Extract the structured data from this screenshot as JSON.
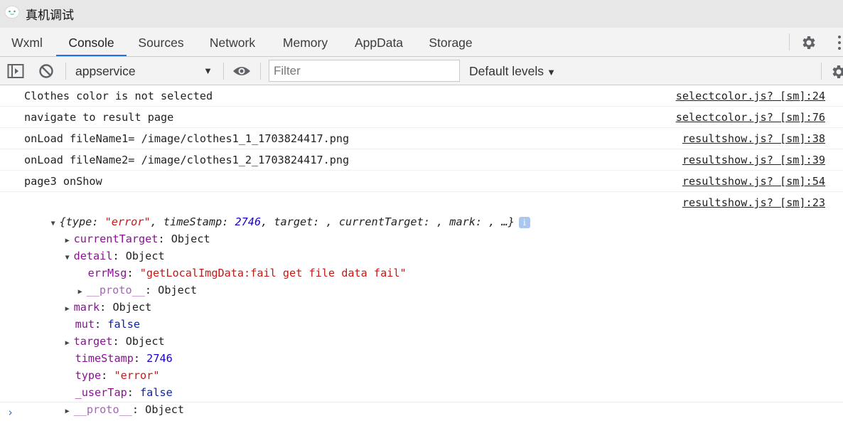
{
  "window": {
    "title": "真机调试"
  },
  "tabs": [
    {
      "label": "Wxml"
    },
    {
      "label": "Console"
    },
    {
      "label": "Sources"
    },
    {
      "label": "Network"
    },
    {
      "label": "Memory"
    },
    {
      "label": "AppData"
    },
    {
      "label": "Storage"
    }
  ],
  "active_tab": "Console",
  "toolbar": {
    "context": "appservice",
    "filter_placeholder": "Filter",
    "levels": "Default levels"
  },
  "icons": {
    "logo": "wechat-devtools-logo",
    "settings": "gear-icon",
    "more": "kebab-menu-icon",
    "sidebar": "sidebar-toggle-icon",
    "clear": "clear-console-icon",
    "live_expression": "eye-icon"
  },
  "colors": {
    "accent": "#1a73e8",
    "key": "#881391",
    "string": "#c41a16",
    "number": "#1c00cf",
    "keyword": "#0d22aa"
  },
  "messages": [
    {
      "text": "Clothes color is not selected",
      "source": "selectcolor.js? [sm]:24"
    },
    {
      "text": "navigate to result page",
      "source": "selectcolor.js? [sm]:76"
    },
    {
      "text": "onLoad fileName1= /image/clothes1_1_1703824417.png",
      "source": "resultshow.js? [sm]:38"
    },
    {
      "text": "onLoad fileName2= /image/clothes1_2_1703824417.png",
      "source": "resultshow.js? [sm]:39"
    },
    {
      "text": "page3 onShow",
      "source": "resultshow.js? [sm]:54"
    }
  ],
  "object_log": {
    "source": "resultshow.js? [sm]:23",
    "preview": {
      "open": "{",
      "k_type": "type",
      "v_type": "\"error\"",
      "k_timestamp": "timeStamp",
      "v_timestamp": "2746",
      "k_target": "target",
      "k_current": "currentTarget",
      "k_mark": "mark",
      "tail": ", …}"
    },
    "info_badge": "i",
    "props": {
      "currentTarget": {
        "key": "currentTarget",
        "value": "Object"
      },
      "detail": {
        "key": "detail",
        "value": "Object"
      },
      "errMsg": {
        "key": "errMsg",
        "value": "\"getLocalImgData:fail get file data fail\""
      },
      "detail_proto": {
        "key": "__proto__",
        "value": "Object"
      },
      "mark": {
        "key": "mark",
        "value": "Object"
      },
      "mut": {
        "key": "mut",
        "value": "false"
      },
      "target": {
        "key": "target",
        "value": "Object"
      },
      "timeStamp": {
        "key": "timeStamp",
        "value": "2746"
      },
      "type": {
        "key": "type",
        "value": "\"error\""
      },
      "userTap": {
        "key": "_userTap",
        "value": "false"
      },
      "proto": {
        "key": "__proto__",
        "value": "Object"
      }
    }
  },
  "prompt_symbol": "›"
}
